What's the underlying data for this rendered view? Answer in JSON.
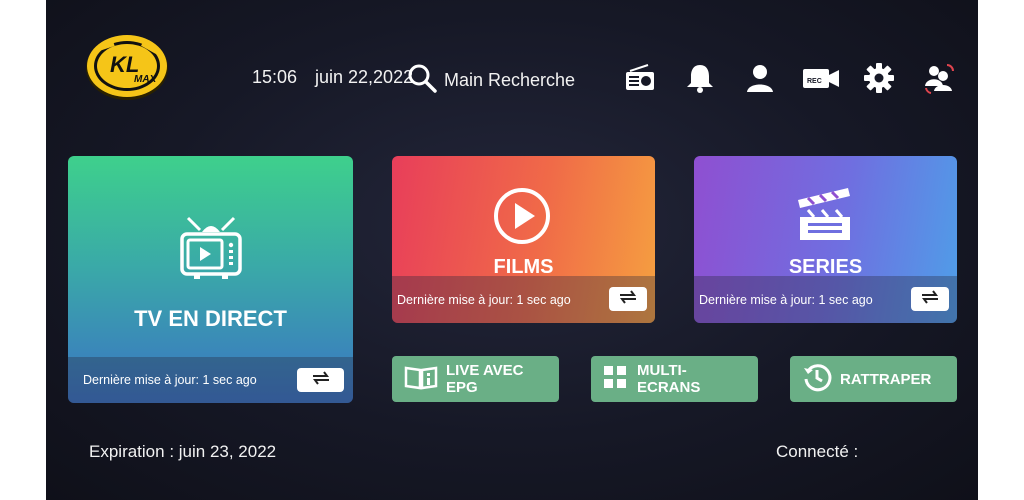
{
  "header": {
    "time": "15:06",
    "date": "juin 22,2022",
    "search_label": "Main Recherche",
    "icons": [
      "radio-icon",
      "bell-icon",
      "user-icon",
      "rec-camera-icon",
      "gear-icon",
      "switch-user-icon"
    ]
  },
  "logo": {
    "text_top": "KL",
    "text_bottom": "MAX"
  },
  "cards": {
    "tv": {
      "title": "TV EN DIRECT",
      "footer": "Dernière mise à jour: 1 sec ago"
    },
    "films": {
      "title": "FILMS",
      "footer": "Dernière mise à jour: 1 sec ago"
    },
    "series": {
      "title": "SERIES",
      "footer": "Dernière mise à jour: 1 sec ago"
    }
  },
  "buttons": {
    "live_epg": {
      "line1": "LIVE AVEC",
      "line2": "EPG"
    },
    "multi": {
      "line1": "MULTI-",
      "line2": "ECRANS"
    },
    "rattraper": {
      "label": "RATTRAPER"
    }
  },
  "footer": {
    "expiration": "Expiration : juin 23, 2022",
    "connected": "Connecté :"
  },
  "colors": {
    "tv_top": "#3ed08c",
    "tv_bottom": "#3a73c4",
    "films": "#f06a48",
    "series": "#6f6fe0",
    "small_button": "#6aaf86",
    "logo_gold": "#f5c518"
  }
}
